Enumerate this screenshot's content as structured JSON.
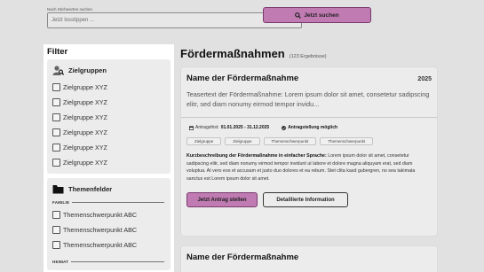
{
  "search": {
    "caption": "Nach Stichworten suchen",
    "placeholder": "Jetzt losstippen ...",
    "button_label": "Jetzt suchen",
    "accent": "#bf7bb2"
  },
  "sidebar": {
    "title": "Filter",
    "zielgruppen": {
      "title": "Zielgruppen",
      "icon": "user-search-icon",
      "items": [
        "Zielgruppe XYZ",
        "Zielgruppe XYZ",
        "Zielgruppe XYZ",
        "Zielgruppe XYZ",
        "Zielgruppe XYZ",
        "Zielgruppe XYZ"
      ]
    },
    "themenfelder": {
      "title": "Themenfelder",
      "icon": "folder-icon",
      "groups": [
        {
          "label": "FAMILIE",
          "items": [
            "Themenschwerpunkt ABC",
            "Themenschwerpunkt ABC",
            "Themenschwerpunkt ABC"
          ]
        },
        {
          "label": "HEIMAT"
        }
      ]
    }
  },
  "main": {
    "title": "Fördermaßnahmen",
    "count": "(123 Ergebnisse)",
    "cards": [
      {
        "title": "Name der Fördermaßnahme",
        "year": "2025",
        "teaser": "Teasertext der Fördermaßnahme: Lorem ipsum dolor sit amet, consetetur sadipscing elitr, sed diam nonumy eirmod tempor invidu...",
        "period_label": "Antragsfrist:",
        "period_value": "01.01.2025 - 31.12.2025",
        "status": "Antragstellung möglich",
        "tags": [
          "Zielgruppe",
          "Zielgruppe",
          "Themenschwerpunkt",
          "Themenschwerpunkt"
        ],
        "desc_label": "Kurzbeschreibung der Fördermaßnahme in einfacher Sprache:",
        "desc_text": "Lorem ipsum dolor sit amet, consetetur sadipscing elitr, sed diam nonumy eirmod tempor invidunt ut labore et dolore magna aliquyam erat, sed diam voluptua. At vero eos et accusam et justo duo dolores et ea rebum. Stet clita kasd gubergren, no sea takimata sanctus est Lorem ipsum dolor sit amet.",
        "primary_button": "Jetzt Antrag stellen",
        "secondary_button": "Detaillierte Information"
      },
      {
        "title": "Name der Fördermaßnahme"
      }
    ]
  }
}
